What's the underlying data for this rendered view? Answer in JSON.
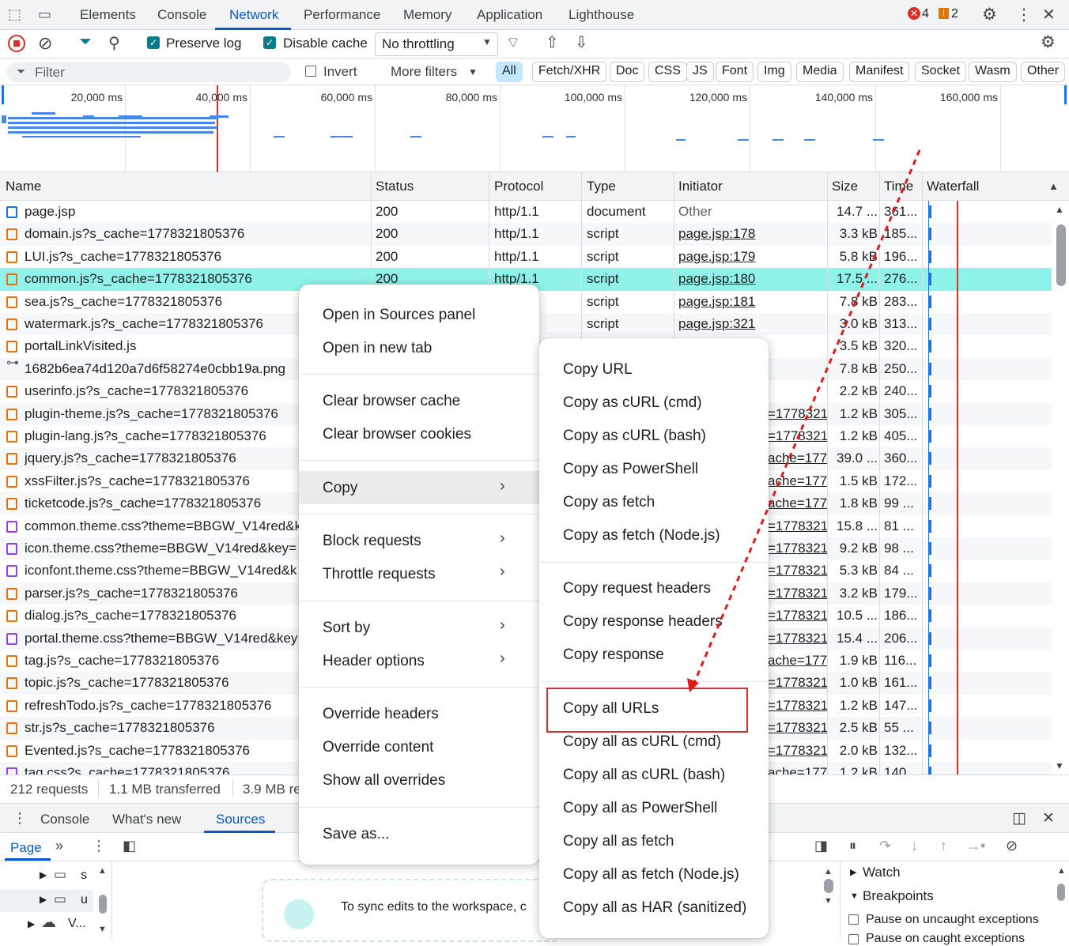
{
  "panel_tabs": [
    "Elements",
    "Console",
    "Network",
    "Performance",
    "Memory",
    "Application",
    "Lighthouse"
  ],
  "issues": {
    "errors": "4",
    "warnings": "2"
  },
  "toolbar": {
    "preserve_log": "Preserve log",
    "disable_cache": "Disable cache",
    "throttling": "No throttling"
  },
  "filter": {
    "placeholder": "Filter",
    "invert": "Invert",
    "more_filters": "More filters"
  },
  "type_chips": [
    "All",
    "Fetch/XHR",
    "Doc",
    "CSS",
    "JS",
    "Font",
    "Img",
    "Media",
    "Manifest",
    "Socket",
    "Wasm",
    "Other"
  ],
  "overview_ticks": [
    "20,000 ms",
    "40,000 ms",
    "60,000 ms",
    "80,000 ms",
    "100,000 ms",
    "120,000 ms",
    "140,000 ms",
    "160,000 ms"
  ],
  "columns": [
    "Name",
    "Status",
    "Protocol",
    "Type",
    "Initiator",
    "Size",
    "Time",
    "Waterfall"
  ],
  "rows": [
    {
      "name": "page.jsp",
      "status": "200",
      "protocol": "http/1.1",
      "type": "document",
      "initiator": "Other",
      "size": "14.7 ...",
      "time": "361...",
      "icon": "doc"
    },
    {
      "name": "domain.js?s_cache=1778321805376",
      "status": "200",
      "protocol": "http/1.1",
      "type": "script",
      "initiator": "page.jsp:178",
      "size": "3.3 kB",
      "time": "185...",
      "icon": "js"
    },
    {
      "name": "LUI.js?s_cache=1778321805376",
      "status": "200",
      "protocol": "http/1.1",
      "type": "script",
      "initiator": "page.jsp:179",
      "size": "5.8 kB",
      "time": "196...",
      "icon": "js"
    },
    {
      "name": "common.js?s_cache=1778321805376",
      "status": "200",
      "protocol": "http/1.1",
      "type": "script",
      "initiator": "page.jsp:180",
      "size": "17.5 ...",
      "time": "276...",
      "icon": "js"
    },
    {
      "name": "sea.js?s_cache=1778321805376",
      "status": "",
      "protocol": "",
      "type": "script",
      "initiator": "page.jsp:181",
      "size": "7.8 kB",
      "time": "283...",
      "icon": "js"
    },
    {
      "name": "watermark.js?s_cache=1778321805376",
      "status": "",
      "protocol": "",
      "type": "script",
      "initiator": "page.jsp:321",
      "size": "3.0 kB",
      "time": "313...",
      "icon": "js"
    },
    {
      "name": "portalLinkVisited.js",
      "status": "",
      "protocol": "",
      "type": "",
      "initiator": "",
      "size": "3.5 kB",
      "time": "320...",
      "icon": "js"
    },
    {
      "name": "1682b6ea74d120a7d6f58274e0cbb19a.png",
      "status": "",
      "protocol": "",
      "type": "",
      "initiator": "",
      "size": "7.8 kB",
      "time": "250...",
      "icon": "img"
    },
    {
      "name": "userinfo.js?s_cache=1778321805376",
      "status": "",
      "protocol": "",
      "type": "",
      "initiator": "",
      "size": "2.2 kB",
      "time": "240...",
      "icon": "js"
    },
    {
      "name": "plugin-theme.js?s_cache=1778321805376",
      "status": "",
      "protocol": "",
      "type": "",
      "initiator": "=1778321",
      "size": "1.2 kB",
      "time": "305...",
      "icon": "js"
    },
    {
      "name": "plugin-lang.js?s_cache=1778321805376",
      "status": "",
      "protocol": "",
      "type": "",
      "initiator": "=1778321",
      "size": "1.2 kB",
      "time": "405...",
      "icon": "js"
    },
    {
      "name": "jquery.js?s_cache=1778321805376",
      "status": "",
      "protocol": "",
      "type": "",
      "initiator": "ache=177",
      "size": "39.0 ...",
      "time": "360...",
      "icon": "js"
    },
    {
      "name": "xssFilter.js?s_cache=1778321805376",
      "status": "",
      "protocol": "",
      "type": "",
      "initiator": "ache=177",
      "size": "1.5 kB",
      "time": "172...",
      "icon": "js"
    },
    {
      "name": "ticketcode.js?s_cache=1778321805376",
      "status": "",
      "protocol": "",
      "type": "",
      "initiator": "ache=177",
      "size": "1.8 kB",
      "time": "99 ...",
      "icon": "js"
    },
    {
      "name": "common.theme.css?theme=BBGW_V14red&k",
      "status": "",
      "protocol": "",
      "type": "",
      "initiator": "=1778321",
      "size": "15.8 ...",
      "time": "81 ...",
      "icon": "css"
    },
    {
      "name": "icon.theme.css?theme=BBGW_V14red&key=",
      "status": "",
      "protocol": "",
      "type": "",
      "initiator": "=1778321",
      "size": "9.2 kB",
      "time": "98 ...",
      "icon": "css"
    },
    {
      "name": "iconfont.theme.css?theme=BBGW_V14red&k",
      "status": "",
      "protocol": "",
      "type": "",
      "initiator": "=1778321",
      "size": "5.3 kB",
      "time": "84 ...",
      "icon": "css"
    },
    {
      "name": "parser.js?s_cache=1778321805376",
      "status": "",
      "protocol": "",
      "type": "",
      "initiator": "=1778321",
      "size": "3.2 kB",
      "time": "179...",
      "icon": "js"
    },
    {
      "name": "dialog.js?s_cache=1778321805376",
      "status": "",
      "protocol": "",
      "type": "",
      "initiator": "=1778321",
      "size": "10.5 ...",
      "time": "186...",
      "icon": "js"
    },
    {
      "name": "portal.theme.css?theme=BBGW_V14red&key",
      "status": "",
      "protocol": "",
      "type": "",
      "initiator": "=1778321",
      "size": "15.4 ...",
      "time": "206...",
      "icon": "css"
    },
    {
      "name": "tag.js?s_cache=1778321805376",
      "status": "",
      "protocol": "",
      "type": "",
      "initiator": "ache=177",
      "size": "1.9 kB",
      "time": "116...",
      "icon": "js"
    },
    {
      "name": "topic.js?s_cache=1778321805376",
      "status": "",
      "protocol": "",
      "type": "",
      "initiator": "=1778321",
      "size": "1.0 kB",
      "time": "161...",
      "icon": "js"
    },
    {
      "name": "refreshTodo.js?s_cache=1778321805376",
      "status": "",
      "protocol": "",
      "type": "",
      "initiator": "=1778321",
      "size": "1.2 kB",
      "time": "147...",
      "icon": "js"
    },
    {
      "name": "str.js?s_cache=1778321805376",
      "status": "",
      "protocol": "",
      "type": "",
      "initiator": "=1778321",
      "size": "2.5 kB",
      "time": "55 ...",
      "icon": "js"
    },
    {
      "name": "Evented.js?s_cache=1778321805376",
      "status": "",
      "protocol": "",
      "type": "",
      "initiator": "=1778321",
      "size": "2.0 kB",
      "time": "132...",
      "icon": "js"
    },
    {
      "name": "tag.css?s_cache=1778321805376",
      "status": "",
      "protocol": "",
      "type": "",
      "initiator": "ache=177",
      "size": "1.2 kB",
      "time": "140...",
      "icon": "css"
    }
  ],
  "status": {
    "requests": "212 requests",
    "transferred": "1.1 MB transferred",
    "resources": "3.9 MB re"
  },
  "drawer_tabs": [
    "Console",
    "What's new",
    "Sources"
  ],
  "sources": {
    "page_tab": "Page",
    "tree": [
      "s",
      "u",
      "V..."
    ],
    "sync_text": "To sync edits to the workspace, c",
    "watch": "Watch",
    "breakpoints": "Breakpoints",
    "pause_uncaught": "Pause on uncaught exceptions",
    "pause_caught": "Pause on caught exceptions"
  },
  "context_menu": {
    "open_sources": "Open in Sources panel",
    "open_tab": "Open in new tab",
    "clear_cache": "Clear browser cache",
    "clear_cookies": "Clear browser cookies",
    "copy": "Copy",
    "block": "Block requests",
    "throttle": "Throttle requests",
    "sort": "Sort by",
    "header_options": "Header options",
    "override_headers": "Override headers",
    "override_content": "Override content",
    "show_overrides": "Show all overrides",
    "save_as": "Save as..."
  },
  "copy_menu": [
    "Copy URL",
    "Copy as cURL (cmd)",
    "Copy as cURL (bash)",
    "Copy as PowerShell",
    "Copy as fetch",
    "Copy as fetch (Node.js)",
    "Copy request headers",
    "Copy response headers",
    "Copy response",
    "Copy all URLs",
    "Copy all as cURL (cmd)",
    "Copy all as cURL (bash)",
    "Copy all as PowerShell",
    "Copy all as fetch",
    "Copy all as fetch (Node.js)",
    "Copy all as HAR (sanitized)"
  ],
  "colors": {
    "accent": "#0b57d0",
    "selected_row": "#8ff3ea",
    "highlight_box": "#d32f2f",
    "arrow": "#e01b1b"
  }
}
